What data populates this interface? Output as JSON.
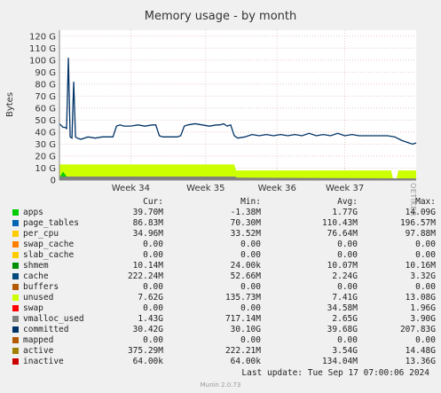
{
  "title": "Memory usage - by month",
  "side_label": "RRDTOOL / TOBI OETIKER",
  "footer": "Munin 2.0.73",
  "last_update": "Last update: Tue Sep 17 07:00:06 2024",
  "legend": {
    "headers": [
      "Cur:",
      "Min:",
      "Avg:",
      "Max:"
    ],
    "rows": [
      {
        "name": "apps",
        "color": "#00cc00",
        "cur": "39.70M",
        "min": "-1.38M",
        "avg": "1.77G",
        "max": "14.09G"
      },
      {
        "name": "page_tables",
        "color": "#0066b3",
        "cur": "86.83M",
        "min": "70.30M",
        "avg": "110.43M",
        "max": "196.57M"
      },
      {
        "name": "per_cpu",
        "color": "#ffcc00",
        "cur": "34.96M",
        "min": "33.52M",
        "avg": "76.64M",
        "max": "97.88M"
      },
      {
        "name": "swap_cache",
        "color": "#ff8000",
        "cur": "0.00",
        "min": "0.00",
        "avg": "0.00",
        "max": "0.00"
      },
      {
        "name": "slab_cache",
        "color": "#ffcc00",
        "cur": "0.00",
        "min": "0.00",
        "avg": "0.00",
        "max": "0.00"
      },
      {
        "name": "shmem",
        "color": "#008f00",
        "cur": "10.14M",
        "min": "24.00k",
        "avg": "10.07M",
        "max": "10.16M"
      },
      {
        "name": "cache",
        "color": "#00487d",
        "cur": "222.24M",
        "min": "52.66M",
        "avg": "2.24G",
        "max": "3.32G"
      },
      {
        "name": "buffers",
        "color": "#b35a00",
        "cur": "0.00",
        "min": "0.00",
        "avg": "0.00",
        "max": "0.00"
      },
      {
        "name": "unused",
        "color": "#ccff00",
        "cur": "7.62G",
        "min": "135.73M",
        "avg": "7.41G",
        "max": "13.08G"
      },
      {
        "name": "swap",
        "color": "#ff0000",
        "cur": "0.00",
        "min": "0.00",
        "avg": "34.58M",
        "max": "1.96G"
      },
      {
        "name": "vmalloc_used",
        "color": "#808080",
        "cur": "1.43G",
        "min": "717.14M",
        "avg": "2.65G",
        "max": "3.90G"
      },
      {
        "name": "committed",
        "color": "#003366",
        "cur": "30.42G",
        "min": "30.10G",
        "avg": "39.68G",
        "max": "207.83G"
      },
      {
        "name": "mapped",
        "color": "#b35a00",
        "cur": "0.00",
        "min": "0.00",
        "avg": "0.00",
        "max": "0.00"
      },
      {
        "name": "active",
        "color": "#a08000",
        "cur": "375.29M",
        "min": "222.21M",
        "avg": "3.54G",
        "max": "14.48G"
      },
      {
        "name": "inactive",
        "color": "#cc0000",
        "cur": "64.00k",
        "min": "64.00k",
        "avg": "134.04M",
        "max": "13.36G"
      }
    ]
  },
  "chart_data": {
    "type": "area",
    "ylabel": "Bytes",
    "y_unit": "G",
    "ylim": [
      0,
      125
    ],
    "y_ticks": [
      0,
      10,
      20,
      30,
      40,
      50,
      60,
      70,
      80,
      90,
      100,
      110,
      120
    ],
    "y_tick_labels": [
      "0",
      "10 G",
      "20 G",
      "30 G",
      "40 G",
      "50 G",
      "60 G",
      "70 G",
      "80 G",
      "90 G",
      "100 G",
      "110 G",
      "120 G"
    ],
    "x_ticks": [
      "Week 34",
      "Week 35",
      "Week 36",
      "Week 37"
    ],
    "x_tick_positions_fraction": [
      0.2,
      0.41,
      0.61,
      0.8
    ],
    "grid": true,
    "series": [
      {
        "name": "committed",
        "color": "#003366",
        "type": "line",
        "points": [
          [
            0,
            47
          ],
          [
            0.01,
            44
          ],
          [
            0.015,
            44
          ],
          [
            0.02,
            43
          ],
          [
            0.025,
            102
          ],
          [
            0.03,
            36
          ],
          [
            0.035,
            35
          ],
          [
            0.04,
            82
          ],
          [
            0.045,
            36
          ],
          [
            0.05,
            35
          ],
          [
            0.06,
            34
          ],
          [
            0.08,
            36
          ],
          [
            0.1,
            35
          ],
          [
            0.12,
            36
          ],
          [
            0.14,
            36
          ],
          [
            0.15,
            36
          ],
          [
            0.16,
            45
          ],
          [
            0.17,
            46
          ],
          [
            0.18,
            45
          ],
          [
            0.2,
            45
          ],
          [
            0.22,
            46
          ],
          [
            0.24,
            45
          ],
          [
            0.26,
            46
          ],
          [
            0.27,
            46
          ],
          [
            0.28,
            37
          ],
          [
            0.29,
            36
          ],
          [
            0.31,
            36
          ],
          [
            0.33,
            36
          ],
          [
            0.34,
            37
          ],
          [
            0.35,
            45
          ],
          [
            0.36,
            46
          ],
          [
            0.38,
            47
          ],
          [
            0.4,
            46
          ],
          [
            0.42,
            45
          ],
          [
            0.44,
            46
          ],
          [
            0.45,
            46
          ],
          [
            0.46,
            47
          ],
          [
            0.47,
            45
          ],
          [
            0.48,
            46
          ],
          [
            0.49,
            37
          ],
          [
            0.5,
            35
          ],
          [
            0.52,
            36
          ],
          [
            0.54,
            38
          ],
          [
            0.56,
            37
          ],
          [
            0.58,
            38
          ],
          [
            0.6,
            37
          ],
          [
            0.62,
            38
          ],
          [
            0.64,
            37
          ],
          [
            0.66,
            38
          ],
          [
            0.68,
            37
          ],
          [
            0.7,
            39
          ],
          [
            0.72,
            37
          ],
          [
            0.74,
            38
          ],
          [
            0.76,
            37
          ],
          [
            0.78,
            39
          ],
          [
            0.8,
            37
          ],
          [
            0.82,
            38
          ],
          [
            0.84,
            37
          ],
          [
            0.86,
            37
          ],
          [
            0.88,
            37
          ],
          [
            0.9,
            37
          ],
          [
            0.92,
            37
          ],
          [
            0.94,
            36
          ],
          [
            0.96,
            33
          ],
          [
            0.97,
            32
          ],
          [
            0.98,
            31
          ],
          [
            0.99,
            30
          ],
          [
            1.0,
            31
          ]
        ]
      },
      {
        "name": "unused",
        "color": "#ccff00",
        "type": "area",
        "points": [
          [
            0,
            13
          ],
          [
            0.49,
            13
          ],
          [
            0.495,
            8
          ],
          [
            0.93,
            8
          ],
          [
            0.935,
            1
          ],
          [
            0.945,
            1
          ],
          [
            0.95,
            8
          ],
          [
            1.0,
            8
          ]
        ]
      },
      {
        "name": "apps",
        "color": "#00cc00",
        "type": "area",
        "points": [
          [
            0,
            2
          ],
          [
            0.01,
            7
          ],
          [
            0.02,
            3
          ],
          [
            0.49,
            3
          ],
          [
            0.5,
            1
          ],
          [
            1.0,
            0.3
          ]
        ]
      },
      {
        "name": "vmalloc_used",
        "color": "#808080",
        "type": "area",
        "points": [
          [
            0,
            3
          ],
          [
            0.49,
            3
          ],
          [
            0.5,
            2
          ],
          [
            1.0,
            1.4
          ]
        ]
      }
    ]
  }
}
